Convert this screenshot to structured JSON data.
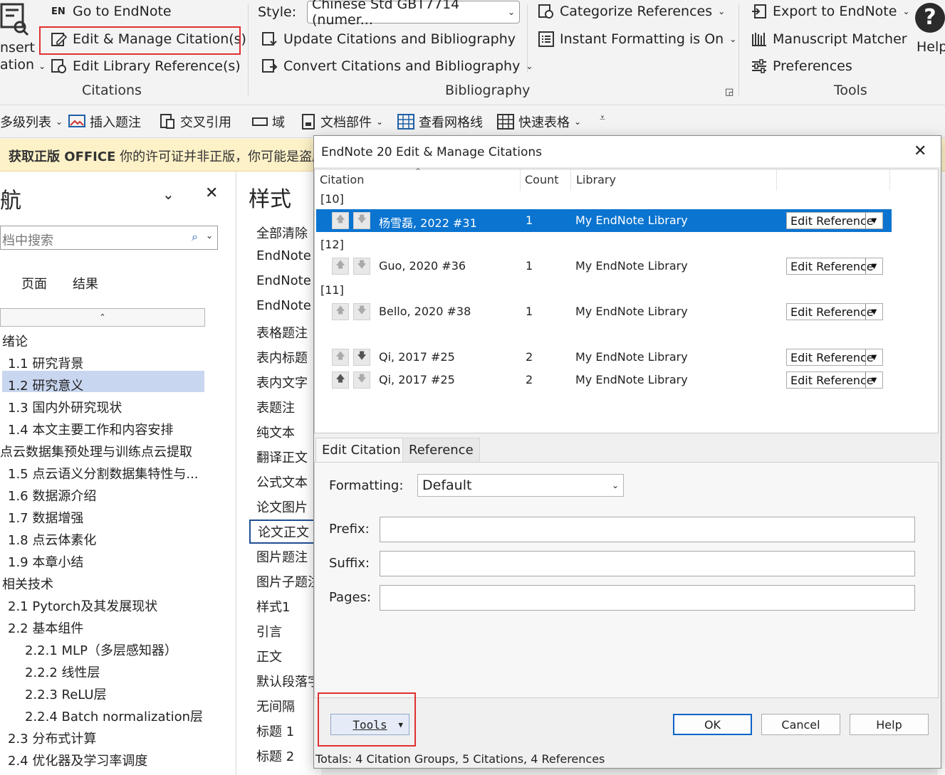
{
  "ribbon": {
    "insert_label_1": "nsert",
    "insert_label_2": "ation",
    "go_to_endnote": "Go to EndNote",
    "edit_manage": "Edit & Manage Citation(s)",
    "edit_library": "Edit Library Reference(s)",
    "citations_group": "Citations",
    "style_label": "Style:",
    "style_value": "Chinese Std GBT7714 (numer...",
    "update_citations": "Update Citations and Bibliography",
    "convert_citations": "Convert Citations and Bibliography",
    "categorize": "Categorize References",
    "instant_formatting": "Instant Formatting is On",
    "bibliography_group": "Bibliography",
    "export": "Export to EndNote",
    "manuscript": "Manuscript Matcher",
    "preferences": "Preferences",
    "tools_group": "Tools",
    "help": "Help",
    "en_badge": "EN"
  },
  "toolbar2": {
    "multilevel": "多级列表",
    "insert_caption": "插入题注",
    "cross_ref": "交叉引用",
    "field": "域",
    "doc_parts": "文档部件",
    "gridlines": "查看网格线",
    "quick_table": "快速表格"
  },
  "banner": {
    "bold": "获取正版 OFFICE",
    "text": "你的许可证并非正版，你可能是盗版"
  },
  "nav": {
    "title": "航",
    "search_placeholder": "档中搜索",
    "tab_pages": "页面",
    "tab_results": "结果",
    "items": [
      "绪论",
      "1.1 研究背景",
      "1.2 研究意义",
      "1.3 国内外研究现状",
      "1.4 本文主要工作和内容安排",
      "点云数据集预处理与训练点云提取",
      "1.5 点云语义分割数据集特性与...",
      "1.6 数据源介绍",
      "1.7 数据增强",
      "1.8 点云体素化",
      "1.9 本章小结",
      "相关技术",
      "2.1 Pytorch及其发展现状",
      "2.2 基本组件",
      "2.2.1 MLP（多层感知器）",
      "2.2.2 线性层",
      "2.2.3 ReLU层",
      "2.2.4 Batch normalization层",
      "2.3 分布式计算",
      "2.4 优化器及学习率调度"
    ]
  },
  "styles": {
    "title": "样式",
    "items": [
      "全部清除",
      "EndNote",
      "EndNote",
      "EndNote",
      "表格题注",
      "表内标题",
      "表内文字",
      "表题注",
      "纯文本",
      "翻译正文",
      "公式文本",
      "论文图片",
      "论文正文",
      "图片题注",
      "图片子题注",
      "样式1",
      "引言",
      "正文",
      "默认段落字",
      "无间隔",
      "标题 1",
      "标题 2"
    ]
  },
  "dialog": {
    "title": "EndNote 20 Edit & Manage Citations",
    "columns": {
      "citation": "Citation",
      "count": "Count",
      "library": "Library"
    },
    "groups": [
      "[10]",
      "[12]",
      "[11]"
    ],
    "rows": [
      {
        "citation": "杨雪磊, 2022 #31",
        "count": "1",
        "library": "My EndNote Library",
        "action": "Edit Reference"
      },
      {
        "citation": "Guo, 2020 #36",
        "count": "1",
        "library": "My EndNote Library",
        "action": "Edit Reference"
      },
      {
        "citation": "Bello, 2020 #38",
        "count": "1",
        "library": "My EndNote Library",
        "action": "Edit Reference"
      },
      {
        "citation": "Qi, 2017 #25",
        "count": "2",
        "library": "My EndNote Library",
        "action": "Edit Reference"
      },
      {
        "citation": "Qi, 2017 #25",
        "count": "2",
        "library": "My EndNote Library",
        "action": "Edit Reference"
      }
    ],
    "tab_edit": "Edit Citation",
    "tab_reference": "Reference",
    "formatting_label": "Formatting:",
    "formatting_value": "Default",
    "prefix_label": "Prefix:",
    "suffix_label": "Suffix:",
    "pages_label": "Pages:",
    "tools_button": "Tools",
    "ok": "OK",
    "cancel": "Cancel",
    "help": "Help",
    "totals": "Totals: 4 Citation Groups, 5 Citations, 4 References"
  },
  "colors": {
    "selection": "#0a74d0",
    "highlight_box": "#e03030",
    "banner": "#fdf1c7"
  }
}
